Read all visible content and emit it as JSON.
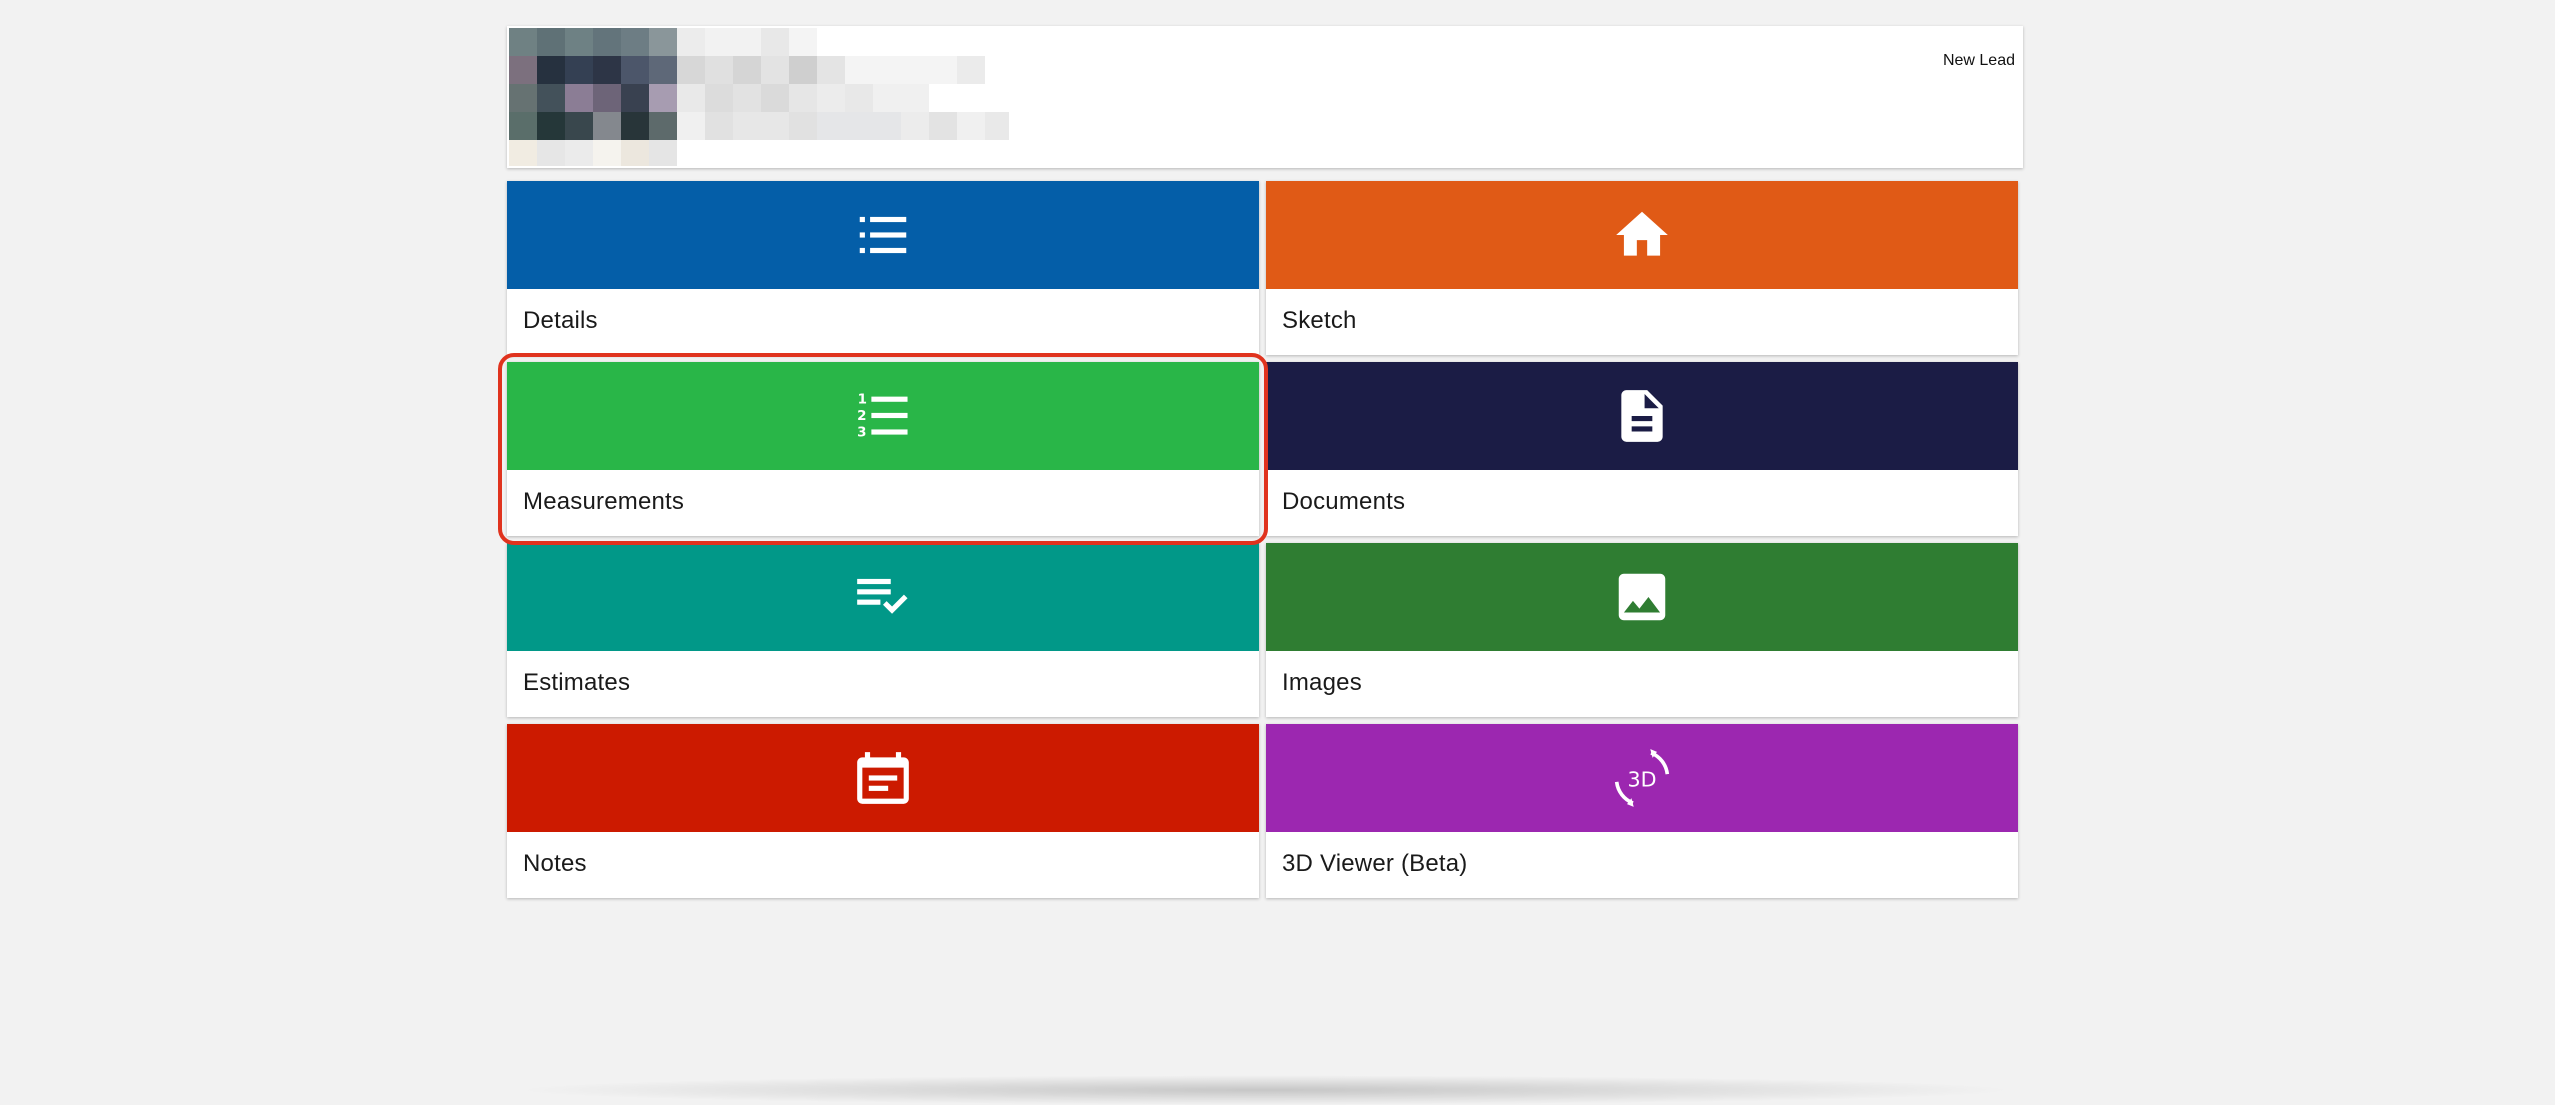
{
  "header": {
    "status": "New Lead"
  },
  "colors": {
    "details": "#045ea8",
    "sketch": "#e05a16",
    "measurements": "#29b648",
    "documents": "#1b1c45",
    "estimates": "#019888",
    "images": "#2f7d32",
    "notes": "#cc1a00",
    "viewer3d": "#9c27b0",
    "highlight": "#e0331e"
  },
  "tiles": [
    {
      "id": "details",
      "label": "Details",
      "icon": "list-icon"
    },
    {
      "id": "sketch",
      "label": "Sketch",
      "icon": "home-icon"
    },
    {
      "id": "measurements",
      "label": "Measurements",
      "icon": "numbered-list-icon"
    },
    {
      "id": "documents",
      "label": "Documents",
      "icon": "document-icon"
    },
    {
      "id": "estimates",
      "label": "Estimates",
      "icon": "checklist-icon"
    },
    {
      "id": "images",
      "label": "Images",
      "icon": "image-icon"
    },
    {
      "id": "notes",
      "label": "Notes",
      "icon": "calendar-note-icon"
    },
    {
      "id": "viewer3d",
      "label": "3D Viewer (Beta)",
      "icon": "3d-rotation-icon",
      "icon_text": "3D"
    }
  ]
}
